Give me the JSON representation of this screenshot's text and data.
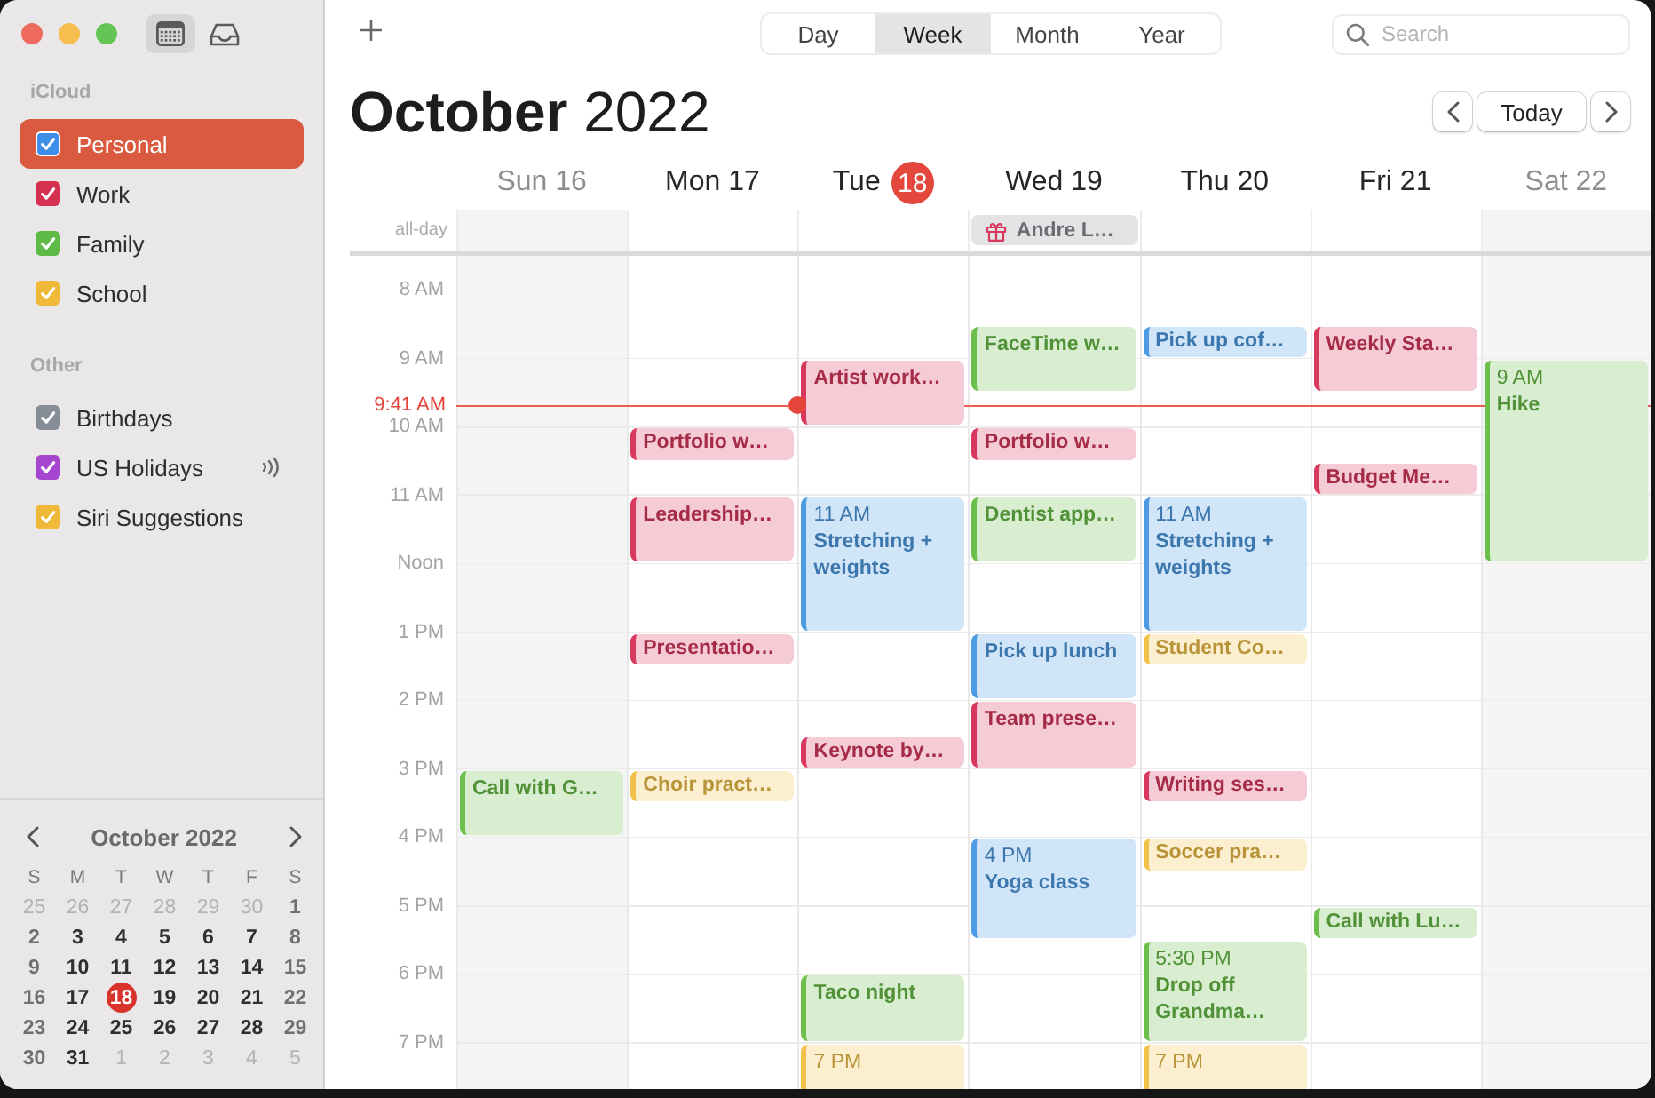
{
  "sidebar": {
    "toolbar": [
      {
        "kind": "calendars",
        "selected": true
      },
      {
        "kind": "inbox",
        "selected": false
      }
    ],
    "sections": [
      {
        "title": "iCloud",
        "items": [
          {
            "name": "Personal",
            "color": "#3d8ee6",
            "checked": true,
            "selected": true,
            "subscribed": false
          },
          {
            "name": "Work",
            "color": "#d5304f",
            "checked": true,
            "selected": false,
            "subscribed": false
          },
          {
            "name": "Family",
            "color": "#5dba45",
            "checked": true,
            "selected": false,
            "subscribed": false
          },
          {
            "name": "School",
            "color": "#f0b93a",
            "checked": true,
            "selected": false,
            "subscribed": false
          }
        ]
      },
      {
        "title": "Other",
        "items": [
          {
            "name": "Birthdays",
            "color": "#878d96",
            "checked": true,
            "selected": false,
            "subscribed": false
          },
          {
            "name": "US Holidays",
            "color": "#a646cf",
            "checked": true,
            "selected": false,
            "subscribed": true
          },
          {
            "name": "Siri Suggestions",
            "color": "#f0b93a",
            "checked": true,
            "selected": false,
            "subscribed": false
          }
        ]
      }
    ],
    "mini_calendar": {
      "title": "October 2022",
      "weekdays": [
        "S",
        "M",
        "T",
        "W",
        "T",
        "F",
        "S"
      ],
      "weeks": [
        [
          {
            "label": "25",
            "outside": true,
            "today": false
          },
          {
            "label": "26",
            "outside": true,
            "today": false
          },
          {
            "label": "27",
            "outside": true,
            "today": false
          },
          {
            "label": "28",
            "outside": true,
            "today": false
          },
          {
            "label": "29",
            "outside": true,
            "today": false
          },
          {
            "label": "30",
            "outside": true,
            "today": false
          },
          {
            "label": "1",
            "outside": false,
            "today": false
          }
        ],
        [
          {
            "label": "2",
            "outside": false,
            "today": false
          },
          {
            "label": "3",
            "outside": false,
            "today": false
          },
          {
            "label": "4",
            "outside": false,
            "today": false
          },
          {
            "label": "5",
            "outside": false,
            "today": false
          },
          {
            "label": "6",
            "outside": false,
            "today": false
          },
          {
            "label": "7",
            "outside": false,
            "today": false
          },
          {
            "label": "8",
            "outside": false,
            "today": false
          }
        ],
        [
          {
            "label": "9",
            "outside": false,
            "today": false
          },
          {
            "label": "10",
            "outside": false,
            "today": false
          },
          {
            "label": "11",
            "outside": false,
            "today": false
          },
          {
            "label": "12",
            "outside": false,
            "today": false
          },
          {
            "label": "13",
            "outside": false,
            "today": false
          },
          {
            "label": "14",
            "outside": false,
            "today": false
          },
          {
            "label": "15",
            "outside": false,
            "today": false
          }
        ],
        [
          {
            "label": "16",
            "outside": false,
            "today": false
          },
          {
            "label": "17",
            "outside": false,
            "today": false
          },
          {
            "label": "18",
            "outside": false,
            "today": true
          },
          {
            "label": "19",
            "outside": false,
            "today": false
          },
          {
            "label": "20",
            "outside": false,
            "today": false
          },
          {
            "label": "21",
            "outside": false,
            "today": false
          },
          {
            "label": "22",
            "outside": false,
            "today": false
          }
        ],
        [
          {
            "label": "23",
            "outside": false,
            "today": false
          },
          {
            "label": "24",
            "outside": false,
            "today": false
          },
          {
            "label": "25",
            "outside": false,
            "today": false
          },
          {
            "label": "26",
            "outside": false,
            "today": false
          },
          {
            "label": "27",
            "outside": false,
            "today": false
          },
          {
            "label": "28",
            "outside": false,
            "today": false
          },
          {
            "label": "29",
            "outside": false,
            "today": false
          }
        ],
        [
          {
            "label": "30",
            "outside": false,
            "today": false
          },
          {
            "label": "31",
            "outside": false,
            "today": false
          },
          {
            "label": "1",
            "outside": true,
            "today": false
          },
          {
            "label": "2",
            "outside": true,
            "today": false
          },
          {
            "label": "3",
            "outside": true,
            "today": false
          },
          {
            "label": "4",
            "outside": true,
            "today": false
          },
          {
            "label": "5",
            "outside": true,
            "today": false
          }
        ]
      ]
    }
  },
  "toolbar": {
    "views": [
      {
        "label": "Day",
        "selected": false
      },
      {
        "label": "Week",
        "selected": true
      },
      {
        "label": "Month",
        "selected": false
      },
      {
        "label": "Year",
        "selected": false
      }
    ],
    "search": {
      "placeholder": "Search"
    }
  },
  "header": {
    "title": "**October** 2022",
    "today_button": "Today"
  },
  "week": {
    "all_day_label": "all-day",
    "hours": [
      "8 AM",
      "9 AM",
      "10 AM",
      "11 AM",
      "Noon",
      "1 PM",
      "2 PM",
      "3 PM",
      "4 PM",
      "5 PM",
      "6 PM",
      "7 PM"
    ],
    "now": {
      "label": "9:41 AM"
    },
    "days": [
      {
        "weekday": "Sun",
        "date": "16",
        "today": false,
        "weekend": true,
        "events": [
          {
            "title": "Call with G…",
            "color": "#6bbf4a"
          }
        ]
      },
      {
        "weekday": "Mon",
        "date": "17",
        "today": false,
        "weekend": false,
        "events": [
          {
            "title": "Portfolio w…",
            "color": "#d9385e"
          },
          {
            "title": "Leadership…",
            "color": "#d9385e"
          },
          {
            "title": "Presentatio…",
            "color": "#d9385e"
          },
          {
            "title": "Choir pract…",
            "color": "#f2c14a"
          }
        ]
      },
      {
        "weekday": "Tue",
        "date": "18",
        "today": true,
        "weekend": false,
        "events": [
          {
            "title": "Artist work…",
            "color": "#d9385e"
          },
          {
            "time": "11 AM",
            "title": "Stretching + weights",
            "color": "#4d9be3"
          },
          {
            "title": "Keynote by…",
            "color": "#d9385e"
          },
          {
            "title": "Taco night",
            "color": "#6bbf4a"
          },
          {
            "time": "7 PM",
            "color": "#f2c14a"
          }
        ]
      },
      {
        "weekday": "Wed",
        "date": "19",
        "today": false,
        "weekend": false,
        "all_day": [
          {
            "title": "Andre L…",
            "kind": "birthday"
          }
        ],
        "events": [
          {
            "title": "FaceTime w…",
            "color": "#6bbf4a"
          },
          {
            "title": "Portfolio w…",
            "color": "#d9385e"
          },
          {
            "title": "Dentist app…",
            "color": "#6bbf4a"
          },
          {
            "title": "Pick up lunch",
            "color": "#4d9be3"
          },
          {
            "title": "Team prese…",
            "color": "#d9385e"
          },
          {
            "time": "4 PM",
            "title": "Yoga class",
            "color": "#4d9be3"
          }
        ]
      },
      {
        "weekday": "Thu",
        "date": "20",
        "today": false,
        "weekend": false,
        "events": [
          {
            "title": "Pick up cof…",
            "color": "#4d9be3"
          },
          {
            "time": "11 AM",
            "title": "Stretching + weights",
            "color": "#4d9be3"
          },
          {
            "title": "Student Co…",
            "color": "#f2c14a"
          },
          {
            "title": "Writing ses…",
            "color": "#d9385e"
          },
          {
            "title": "Soccer pra…",
            "color": "#f2c14a"
          },
          {
            "time": "5:30 PM",
            "title": "Drop off Grandma…",
            "color": "#6bbf4a"
          },
          {
            "time": "7 PM",
            "color": "#f2c14a"
          }
        ]
      },
      {
        "weekday": "Fri",
        "date": "21",
        "today": false,
        "weekend": false,
        "events": [
          {
            "title": "Weekly Sta…",
            "color": "#d9385e"
          },
          {
            "title": "Budget Me…",
            "color": "#d9385e"
          },
          {
            "title": "Call with Lu…",
            "color": "#6bbf4a"
          }
        ]
      },
      {
        "weekday": "Sat",
        "date": "22",
        "today": false,
        "weekend": true,
        "events": [
          {
            "time": "9 AM",
            "title": "Hike",
            "color": "#6bbf4a"
          }
        ]
      }
    ]
  }
}
